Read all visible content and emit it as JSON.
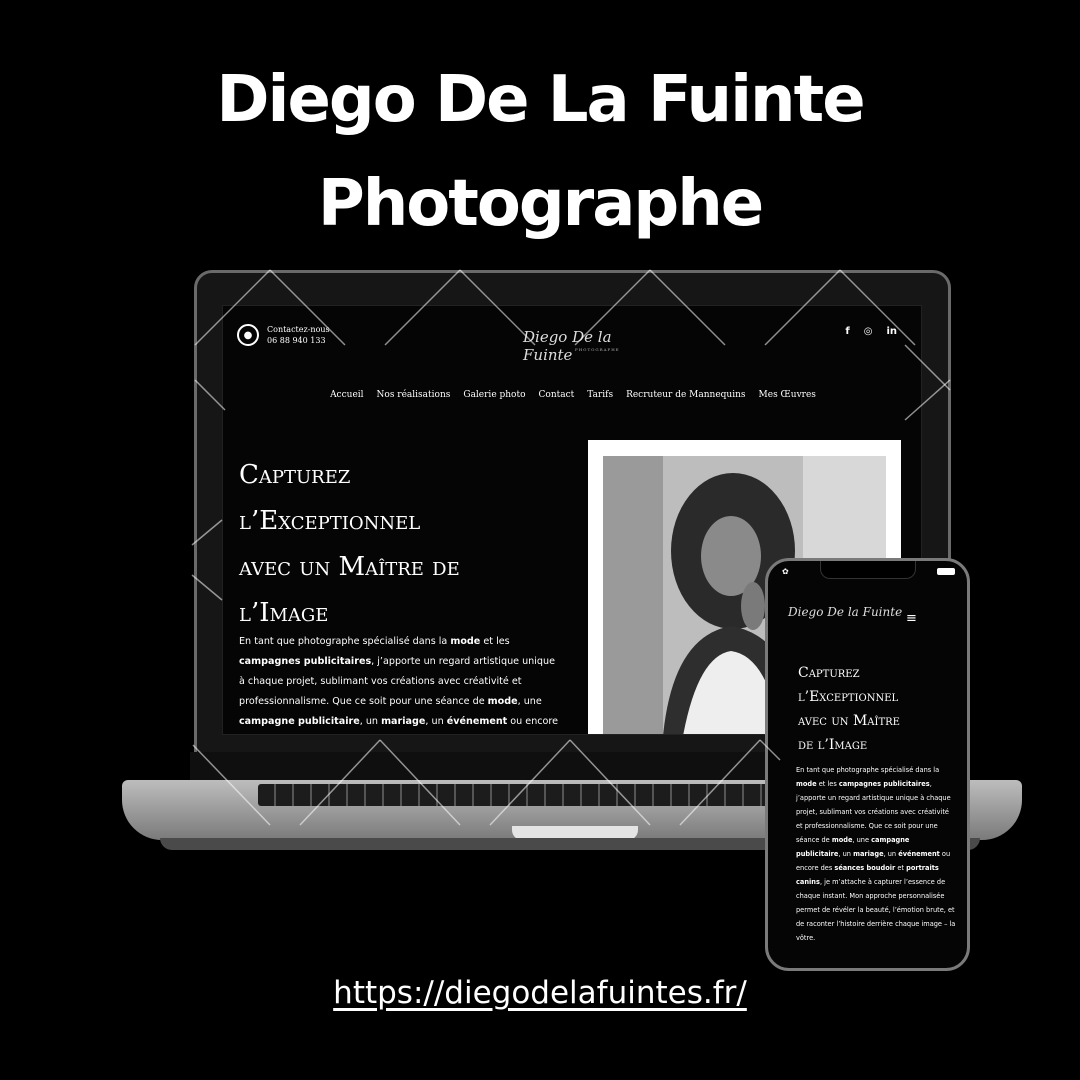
{
  "headline": {
    "line1": "Diego De La Fuinte",
    "line2": "Photographe"
  },
  "url": "https://diegodelafuintes.fr/",
  "site": {
    "contact_label": "Contactez-nous",
    "contact_phone": "06 88 940 133",
    "logo": "Diego De la Fuinte",
    "logo_sub": "PHOTOGRAPHE",
    "social": [
      "f",
      "◎",
      "in"
    ],
    "nav": [
      "Accueil",
      "Nos réalisations",
      "Galerie photo",
      "Contact",
      "Tarifs",
      "Recruteur de Mannequins",
      "Mes Œuvres"
    ],
    "title": [
      "Capturez",
      "l’Exceptionnel",
      "avec un Maître de",
      "l’Image"
    ],
    "para": [
      {
        "t": "En tant que photographe spécialisé dans la ",
        "b": false
      },
      {
        "t": "mode",
        "b": true
      },
      {
        "t": " et les ",
        "b": false
      },
      {
        "t": "campagnes publicitaires",
        "b": true
      },
      {
        "t": ", j’apporte un regard artistique unique à chaque projet, sublimant vos créations avec créativité et professionnalisme. Que ce soit pour une séance de ",
        "b": false
      },
      {
        "t": "mode",
        "b": true
      },
      {
        "t": ", une ",
        "b": false
      },
      {
        "t": "campagne publicitaire",
        "b": true
      },
      {
        "t": ", un ",
        "b": false
      },
      {
        "t": "mariage",
        "b": true
      },
      {
        "t": ", un ",
        "b": false
      },
      {
        "t": "événement",
        "b": true
      },
      {
        "t": " ou encore",
        "b": false
      }
    ]
  },
  "phone": {
    "logo": "Diego De la Fuinte",
    "menu": "≡",
    "title": [
      "Capturez",
      "l’Exceptionnel",
      "avec un Maître",
      "de l’Image"
    ],
    "para": [
      {
        "t": "En tant que photographe spécialisé dans la ",
        "b": false
      },
      {
        "t": "mode",
        "b": true
      },
      {
        "t": " et les ",
        "b": false
      },
      {
        "t": "campagnes publicitaires",
        "b": true
      },
      {
        "t": ", j’apporte un regard artistique unique à chaque projet, sublimant vos créations avec créativité et professionnalisme. Que ce soit pour une séance de ",
        "b": false
      },
      {
        "t": "mode",
        "b": true
      },
      {
        "t": ", une ",
        "b": false
      },
      {
        "t": "campagne publicitaire",
        "b": true
      },
      {
        "t": ", un ",
        "b": false
      },
      {
        "t": "mariage",
        "b": true
      },
      {
        "t": ", un ",
        "b": false
      },
      {
        "t": "événement",
        "b": true
      },
      {
        "t": " ou encore des ",
        "b": false
      },
      {
        "t": "séances boudoir",
        "b": true
      },
      {
        "t": " et ",
        "b": false
      },
      {
        "t": "portraits canins",
        "b": true
      },
      {
        "t": ", je m’attache à capturer l’essence de chaque instant. Mon approche personnalisée permet de révéler la beauté, l’émotion brute, et de raconter l’histoire derrière chaque image – la vôtre.",
        "b": false
      }
    ]
  },
  "colors": {
    "background": "#000000",
    "text": "#ffffff",
    "device_frame": "#7a7a7a"
  }
}
